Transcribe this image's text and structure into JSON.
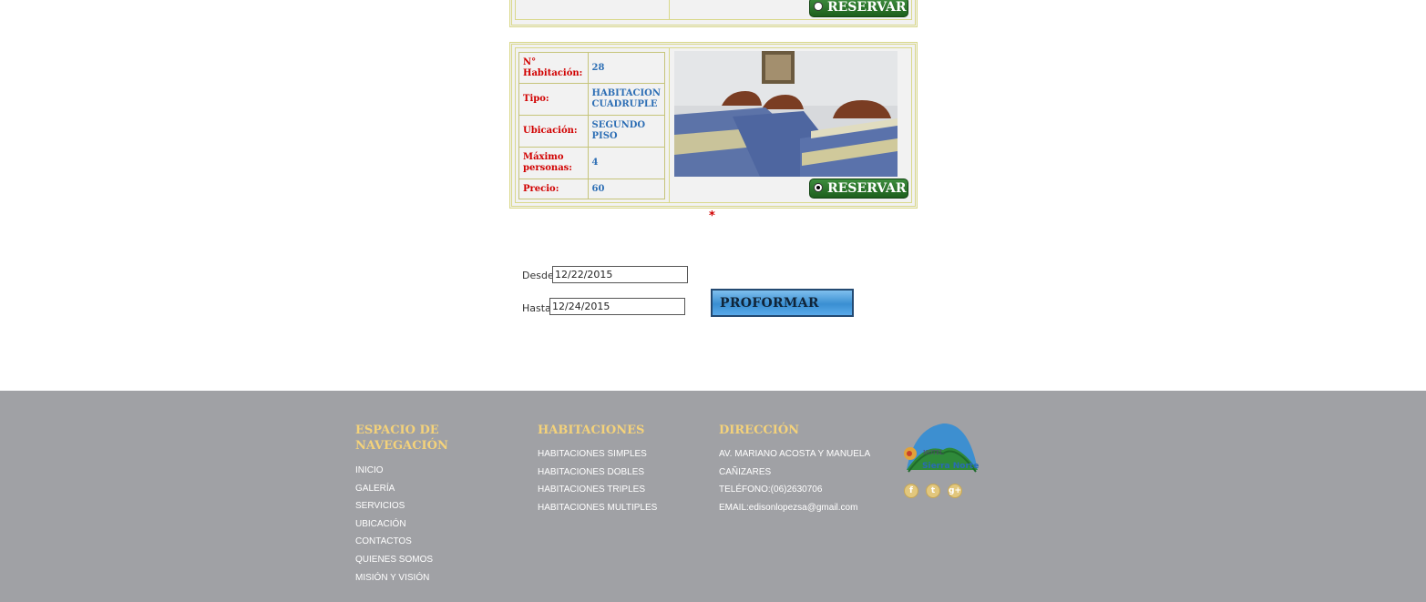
{
  "room_top": {
    "reservar_label": "RESERVAR"
  },
  "room": {
    "rows": [
      {
        "label": "N° Habitación:",
        "value": "28"
      },
      {
        "label": "Tipo:",
        "value": "HABITACION CUADRUPLE"
      },
      {
        "label": "Ubicación:",
        "value": "SEGUNDO PISO"
      },
      {
        "label": "Máximo personas:",
        "value": "4"
      },
      {
        "label": "Precio:",
        "value": "60"
      }
    ],
    "reservar_label": "RESERVAR"
  },
  "asterisk": "*",
  "form": {
    "desde_label": "Desde",
    "desde_value": "12/22/2015",
    "hasta_label": "Hasta",
    "hasta_value": "12/24/2015",
    "proformar_label": "PROFORMAR"
  },
  "footer": {
    "nav_title": "ESPACIO DE NAVEGACIÓN",
    "nav_links": [
      "INICIO",
      "GALERÍA",
      "SERVICIOS",
      "UBICACIÓN",
      "CONTACTOS",
      "QUIENES SOMOS",
      "MISIÓN Y VISIÓN"
    ],
    "rooms_title": "HABITACIONES",
    "rooms_links": [
      "HABITACIONES SIMPLES",
      "HABITACIONES DOBLES",
      "HABITACIONES TRIPLES",
      "HABITACIONES MULTIPLES"
    ],
    "address_title": "DIRECCIÓN",
    "address_lines": [
      "AV. MARIANO ACOSTA Y MANUELA",
      "CAÑIZARES",
      "TELÉFONO:(06)2630706",
      "EMAIL:edisonlopezsa@gmail.com"
    ],
    "logo_text": [
      "HOTEL",
      "Sierra Norte"
    ],
    "social": [
      {
        "icon": "facebook-icon",
        "glyph": "f"
      },
      {
        "icon": "twitter-icon",
        "glyph": "t"
      },
      {
        "icon": "google-plus-icon",
        "glyph": "g+"
      }
    ]
  },
  "colors": {
    "label_red": "#d10000",
    "value_blue": "#2e6fb5",
    "footer_bg": "#a0a1a5",
    "footer_heading": "#f4d27a",
    "reservar_green": "#2a742a"
  }
}
